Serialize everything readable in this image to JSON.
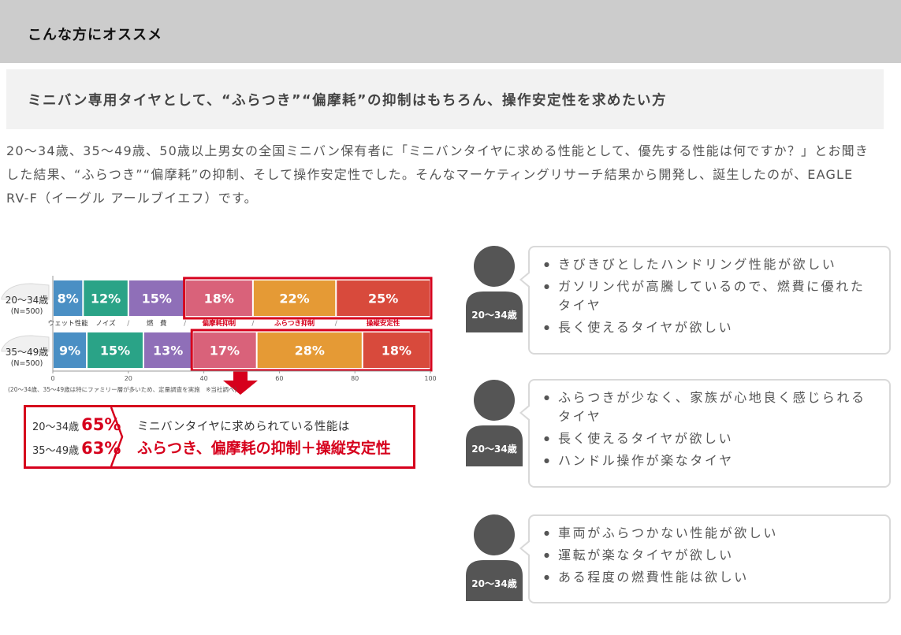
{
  "header": {
    "title": "こんな方にオススメ"
  },
  "subhead": "ミニバン専用タイヤとして、“ふらつき”“偏摩耗”の抑制はもちろん、操作安定性を求めたい方",
  "intro": "20～34歳、35～49歳、50歳以上男女の全国ミニバン保有者に「ミニバンタイヤに求める性能として、優先する性能は何ですか？」とお聞きした結果、“ふらつき”“偏摩耗”の抑制、そして操作安定性でした。そんなマーケティングリサーチ結果から開発し、誕生したのが、EAGLE RV-F（イーグル アールブイエフ）です。",
  "chart_data": {
    "type": "bar",
    "orientation": "horizontal",
    "stacked": true,
    "xlim": [
      0,
      100
    ],
    "xticks": [
      "0",
      "20",
      "40",
      "60",
      "80",
      "100"
    ],
    "categories": [
      {
        "label": "20〜34歳",
        "n": "(N=500)"
      },
      {
        "label": "35〜49歳",
        "n": "(N=500)"
      }
    ],
    "series": [
      {
        "name": "ウェット性能",
        "values": [
          8,
          9
        ],
        "labels": [
          "8%",
          "9%"
        ],
        "color": "#4a8fc4"
      },
      {
        "name": "ノイズ",
        "values": [
          12,
          15
        ],
        "labels": [
          "12%",
          "15%"
        ],
        "color": "#2aa387"
      },
      {
        "name": "燃　費",
        "values": [
          15,
          13
        ],
        "labels": [
          "15%",
          "13%"
        ],
        "color": "#8f6fb8"
      },
      {
        "name": "偏摩耗抑制",
        "values": [
          18,
          17
        ],
        "labels": [
          "18%",
          "17%"
        ],
        "color": "#d9627a"
      },
      {
        "name": "ふらつき抑制",
        "values": [
          22,
          28
        ],
        "labels": [
          "22%",
          "28%"
        ],
        "color": "#e59a35"
      },
      {
        "name": "操縦安定性",
        "values": [
          25,
          18
        ],
        "labels": [
          "25%",
          "18%"
        ],
        "color": "#d84a3c"
      }
    ],
    "footnote": "(20〜34歳、35〜49歳は特にファミリー層が多いため、定量調査を実施　※当社調べ)",
    "highlight_color": "#d6001c"
  },
  "summary": {
    "rows": [
      {
        "label": "20〜34歳",
        "pct": "65%"
      },
      {
        "label": "35〜49歳",
        "pct": "63%"
      }
    ],
    "line1": "ミニバンタイヤに求められている性能は",
    "line2a": "ふらつき、偏摩耗の抑制",
    "line2plus": "＋",
    "line2b": "操縦安定性"
  },
  "personas": [
    {
      "label": "20〜34歳",
      "items": [
        "きびきびとしたハンドリング性能が欲しい",
        "ガソリン代が高騰しているので、燃費に優れたタイヤ",
        "長く使えるタイヤが欲しい"
      ]
    },
    {
      "label": "20〜34歳",
      "items": [
        "ふらつきが少なく、家族が心地良く感じられるタイヤ",
        "長く使えるタイヤが欲しい",
        "ハンドル操作が楽なタイヤ"
      ]
    },
    {
      "label": "20〜34歳",
      "items": [
        "車両がふらつかない性能が欲しい",
        "運転が楽なタイヤが欲しい",
        "ある程度の燃費性能は欲しい"
      ]
    }
  ],
  "colors": {
    "avatar": "#555555",
    "accent": "#d6001c",
    "header_bg": "#cccccc"
  }
}
